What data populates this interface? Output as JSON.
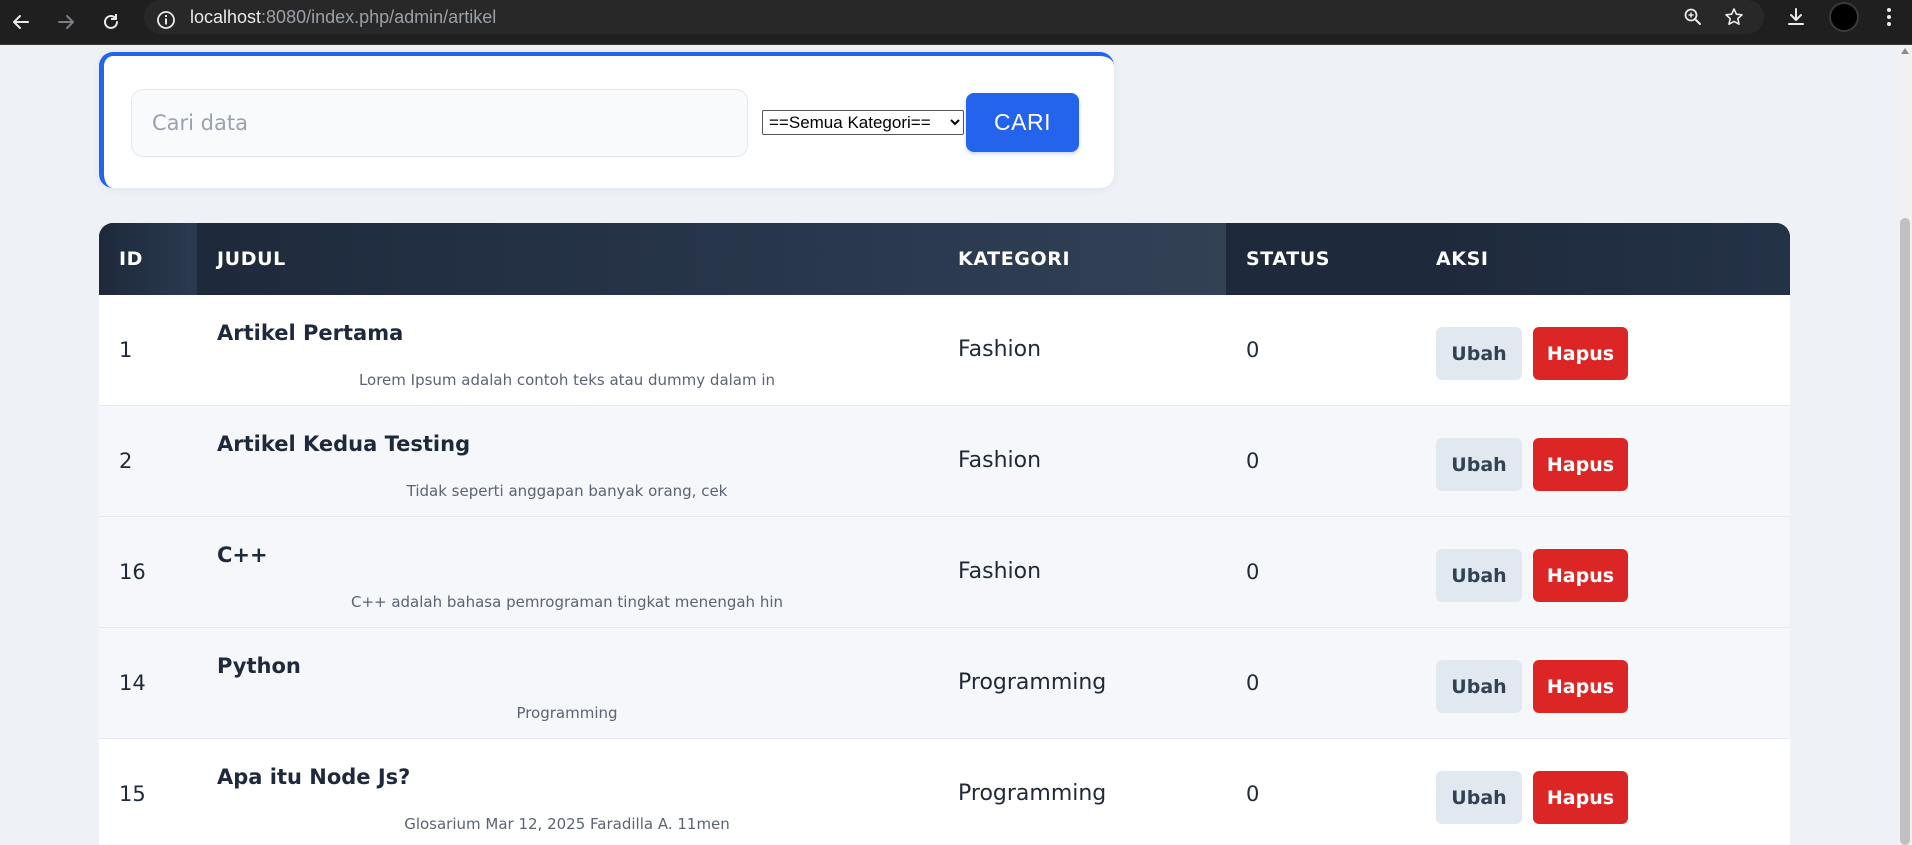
{
  "browser": {
    "url_host": "localhost",
    "url_path": ":8080/index.php/admin/artikel"
  },
  "search": {
    "placeholder": "Cari data",
    "value": "",
    "category_selected": "==Semua Kategori==",
    "button_label": "CARI"
  },
  "table": {
    "headers": {
      "id": "ID",
      "judul": "JUDUL",
      "kategori": "KATEGORI",
      "status": "STATUS",
      "aksi": "AKSI"
    },
    "rows": [
      {
        "id": "1",
        "title": "Artikel Pertama",
        "excerpt": "Lorem Ipsum adalah contoh teks atau dummy dalam in",
        "kategori": "Fashion",
        "status": "0",
        "edit_label": "Ubah",
        "delete_label": "Hapus"
      },
      {
        "id": "2",
        "title": "Artikel Kedua Testing",
        "excerpt": "Tidak seperti anggapan banyak orang, cek",
        "kategori": "Fashion",
        "status": "0",
        "edit_label": "Ubah",
        "delete_label": "Hapus"
      },
      {
        "id": "16",
        "title": "C++",
        "excerpt": "C++ adalah bahasa pemrograman tingkat menengah hin",
        "kategori": "Fashion",
        "status": "0",
        "edit_label": "Ubah",
        "delete_label": "Hapus"
      },
      {
        "id": "14",
        "title": "Python",
        "excerpt": "Programming",
        "kategori": "Programming",
        "status": "0",
        "edit_label": "Ubah",
        "delete_label": "Hapus"
      },
      {
        "id": "15",
        "title": "Apa itu Node Js?",
        "excerpt": "Glosarium Mar 12, 2025 Faradilla A. 11men",
        "kategori": "Programming",
        "status": "0",
        "edit_label": "Ubah",
        "delete_label": "Hapus"
      }
    ]
  },
  "colors": {
    "accent": "#2463eb",
    "header_bg": "#1e293b",
    "delete": "#dc2626",
    "edit_bg": "#e2e8f0"
  }
}
